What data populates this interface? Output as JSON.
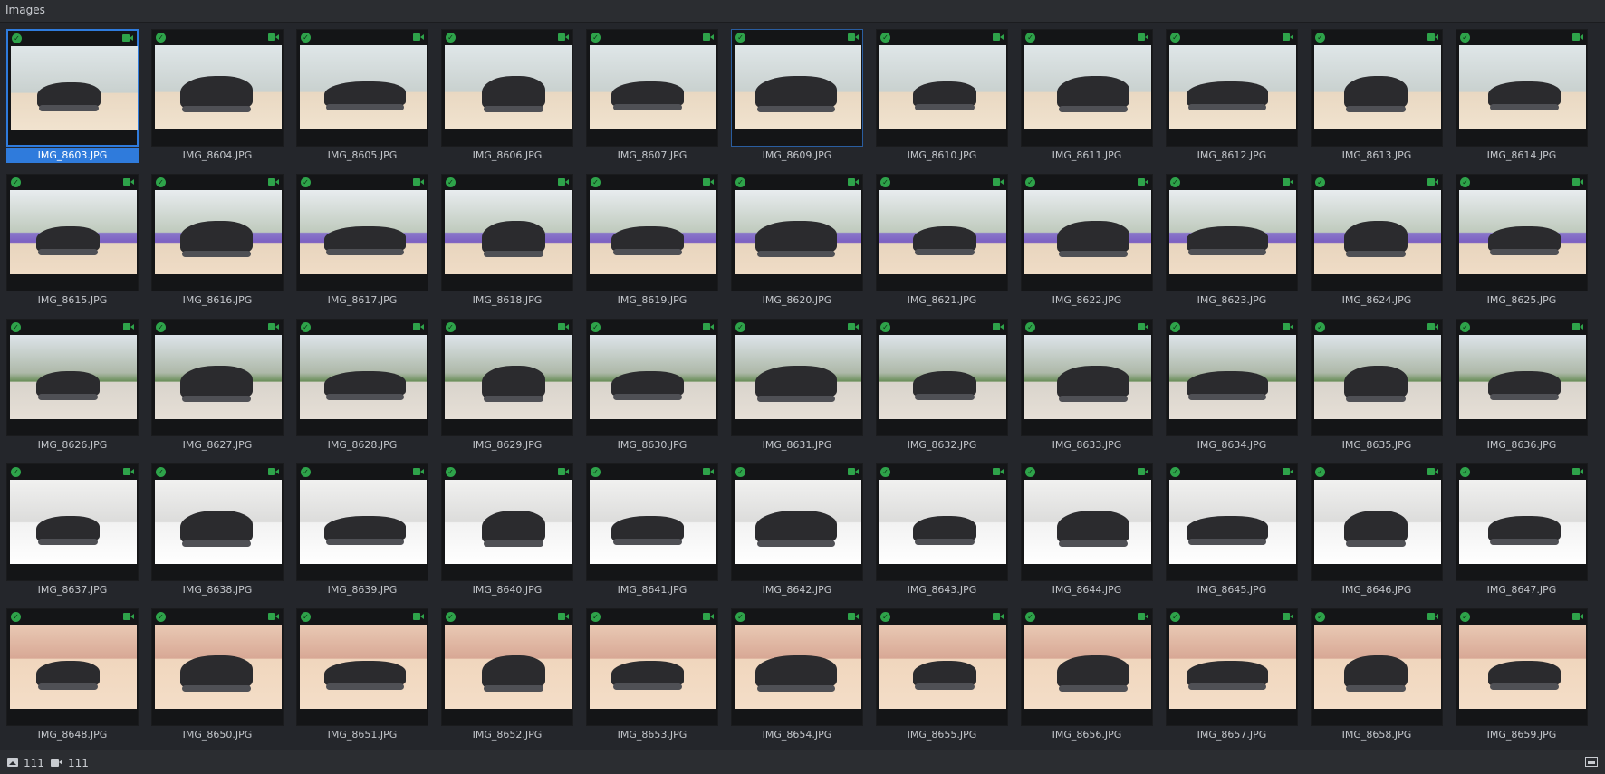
{
  "header": {
    "title": "Images"
  },
  "colors": {
    "accent": "#2f7bdc",
    "status_ok": "#2ea34a",
    "background": "#24262b"
  },
  "icons": {
    "status": "check-circle-icon",
    "camera": "camera-icon",
    "images": "image-icon",
    "videos": "video-icon",
    "thumbnails": "thumbnail-toggle-icon"
  },
  "images": [
    {
      "name": "IMG_8603.JPG",
      "selected": true
    },
    {
      "name": "IMG_8604.JPG"
    },
    {
      "name": "IMG_8605.JPG"
    },
    {
      "name": "IMG_8606.JPG"
    },
    {
      "name": "IMG_8607.JPG"
    },
    {
      "name": "IMG_8609.JPG",
      "highlight": true
    },
    {
      "name": "IMG_8610.JPG"
    },
    {
      "name": "IMG_8611.JPG"
    },
    {
      "name": "IMG_8612.JPG"
    },
    {
      "name": "IMG_8613.JPG"
    },
    {
      "name": "IMG_8614.JPG"
    },
    {
      "name": "IMG_8615.JPG"
    },
    {
      "name": "IMG_8616.JPG"
    },
    {
      "name": "IMG_8617.JPG"
    },
    {
      "name": "IMG_8618.JPG"
    },
    {
      "name": "IMG_8619.JPG"
    },
    {
      "name": "IMG_8620.JPG"
    },
    {
      "name": "IMG_8621.JPG"
    },
    {
      "name": "IMG_8622.JPG"
    },
    {
      "name": "IMG_8623.JPG"
    },
    {
      "name": "IMG_8624.JPG"
    },
    {
      "name": "IMG_8625.JPG"
    },
    {
      "name": "IMG_8626.JPG"
    },
    {
      "name": "IMG_8627.JPG"
    },
    {
      "name": "IMG_8628.JPG"
    },
    {
      "name": "IMG_8629.JPG"
    },
    {
      "name": "IMG_8630.JPG"
    },
    {
      "name": "IMG_8631.JPG"
    },
    {
      "name": "IMG_8632.JPG"
    },
    {
      "name": "IMG_8633.JPG"
    },
    {
      "name": "IMG_8634.JPG"
    },
    {
      "name": "IMG_8635.JPG"
    },
    {
      "name": "IMG_8636.JPG"
    },
    {
      "name": "IMG_8637.JPG"
    },
    {
      "name": "IMG_8638.JPG"
    },
    {
      "name": "IMG_8639.JPG"
    },
    {
      "name": "IMG_8640.JPG"
    },
    {
      "name": "IMG_8641.JPG"
    },
    {
      "name": "IMG_8642.JPG"
    },
    {
      "name": "IMG_8643.JPG"
    },
    {
      "name": "IMG_8644.JPG"
    },
    {
      "name": "IMG_8645.JPG"
    },
    {
      "name": "IMG_8646.JPG"
    },
    {
      "name": "IMG_8647.JPG"
    },
    {
      "name": "IMG_8648.JPG"
    },
    {
      "name": "IMG_8650.JPG"
    },
    {
      "name": "IMG_8651.JPG"
    },
    {
      "name": "IMG_8652.JPG"
    },
    {
      "name": "IMG_8653.JPG"
    },
    {
      "name": "IMG_8654.JPG"
    },
    {
      "name": "IMG_8655.JPG"
    },
    {
      "name": "IMG_8656.JPG"
    },
    {
      "name": "IMG_8657.JPG"
    },
    {
      "name": "IMG_8658.JPG"
    },
    {
      "name": "IMG_8659.JPG"
    }
  ],
  "footer": {
    "image_count": "111",
    "video_count": "111"
  }
}
